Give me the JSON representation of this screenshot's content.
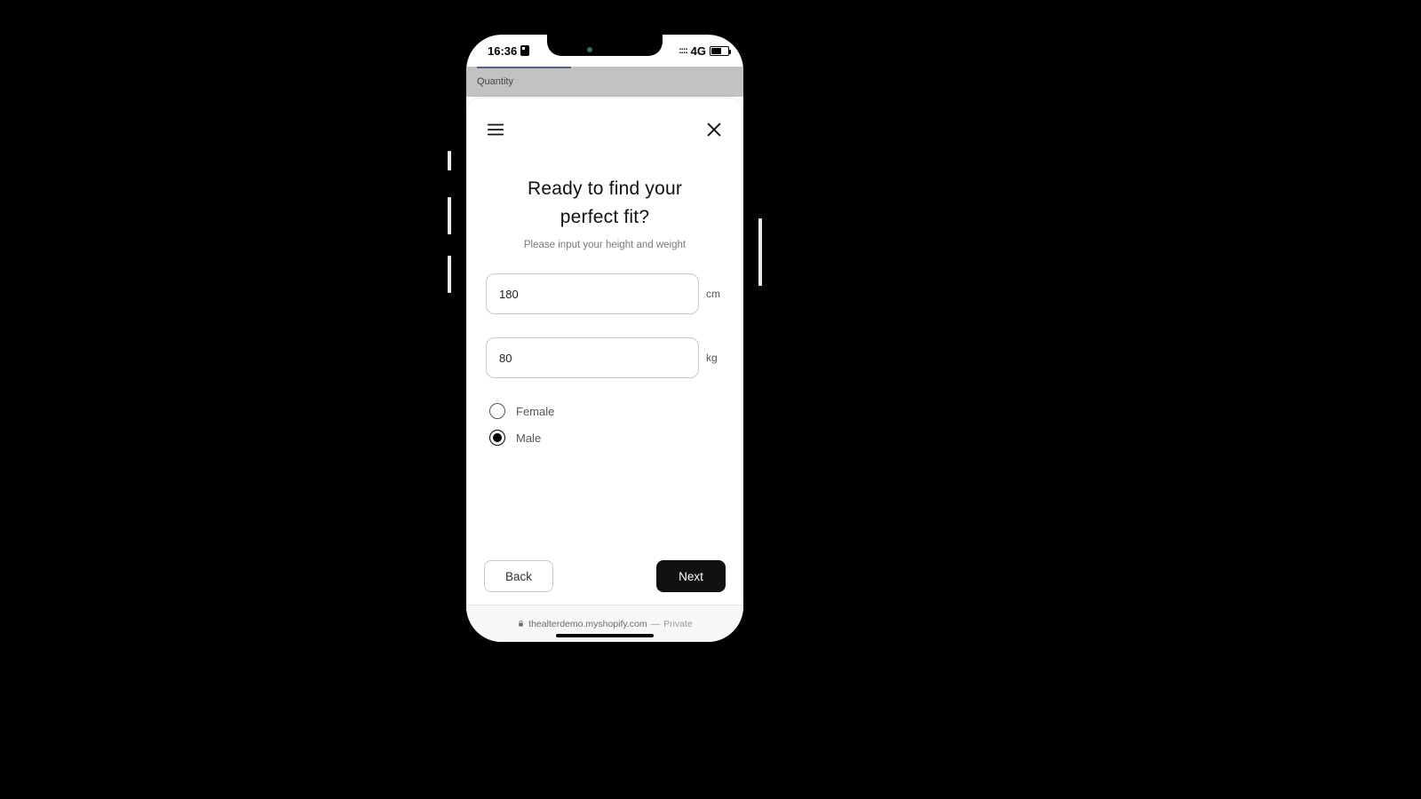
{
  "statusbar": {
    "time": "16:36",
    "network_label": "4G"
  },
  "background_page": {
    "quantity_label": "Quantity"
  },
  "modal": {
    "title_line1": "Ready to find your",
    "title_line2": "perfect fit?",
    "subtitle": "Please input your height and weight",
    "height": {
      "value": "180",
      "unit": "cm"
    },
    "weight": {
      "value": "80",
      "unit": "kg"
    },
    "gender": {
      "options": [
        {
          "label": "Female",
          "selected": false
        },
        {
          "label": "Male",
          "selected": true
        }
      ]
    },
    "back_label": "Back",
    "next_label": "Next"
  },
  "browser": {
    "domain": "thealterdemo.myshopify.com",
    "separator": " — ",
    "mode": "Private"
  }
}
